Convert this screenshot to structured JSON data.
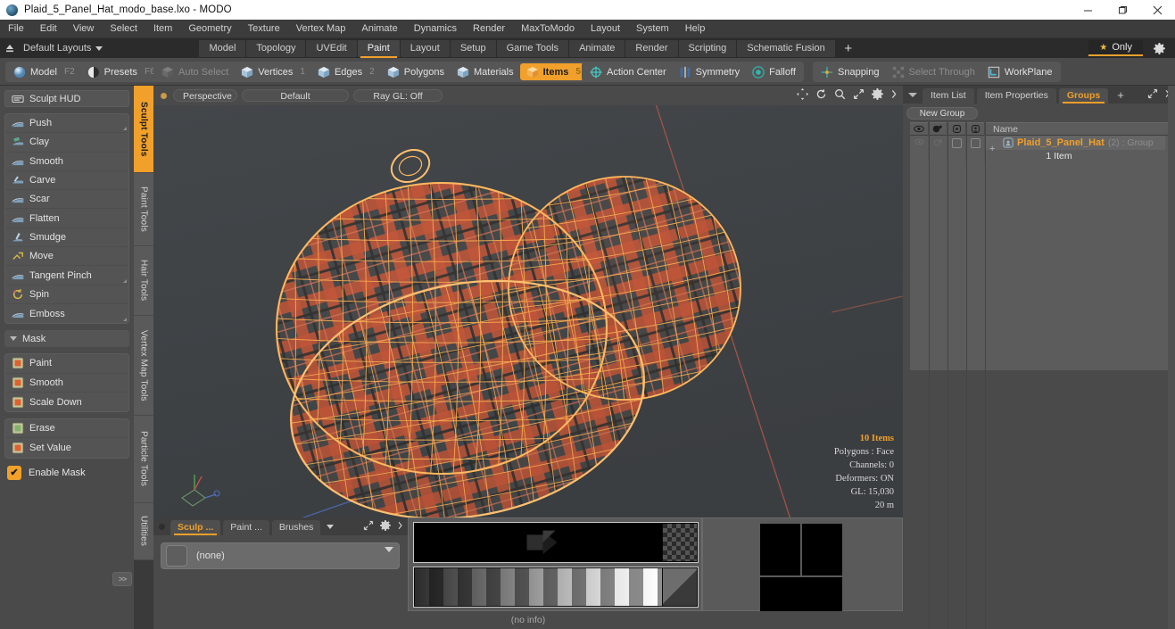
{
  "window": {
    "title": "Plaid_5_Panel_Hat_modo_base.lxo - MODO",
    "minimize": "—",
    "maximize": "❐",
    "close": "✕"
  },
  "menubar": {
    "items": [
      "File",
      "Edit",
      "View",
      "Select",
      "Item",
      "Geometry",
      "Texture",
      "Vertex Map",
      "Animate",
      "Dynamics",
      "Render",
      "MaxToModo",
      "Layout",
      "System",
      "Help"
    ]
  },
  "layoutbar": {
    "layouts_label": "Default Layouts",
    "tabs": [
      {
        "label": "Model",
        "active": false
      },
      {
        "label": "Topology",
        "active": false
      },
      {
        "label": "UVEdit",
        "active": false
      },
      {
        "label": "Paint",
        "active": true
      },
      {
        "label": "Layout",
        "active": false
      },
      {
        "label": "Setup",
        "active": false
      },
      {
        "label": "Game Tools",
        "active": false
      },
      {
        "label": "Animate",
        "active": false
      },
      {
        "label": "Render",
        "active": false
      },
      {
        "label": "Scripting",
        "active": false
      },
      {
        "label": "Schematic Fusion",
        "active": false
      }
    ],
    "add_label": "+",
    "only_label": "Only"
  },
  "modebar": {
    "left_group": [
      {
        "label": "Model",
        "key": "F2",
        "state": "normal",
        "icon": "sphere-icon"
      },
      {
        "label": "Presets",
        "key": "F6",
        "state": "normal",
        "icon": "preset-icon"
      }
    ],
    "select_group": [
      {
        "label": "Auto Select",
        "key": "",
        "state": "disabled",
        "icon": "cube-icon"
      },
      {
        "label": "Vertices",
        "key": "1",
        "state": "normal",
        "icon": "cube-icon"
      },
      {
        "label": "Edges",
        "key": "2",
        "state": "normal",
        "icon": "cube-icon"
      },
      {
        "label": "Polygons",
        "key": "",
        "state": "normal",
        "icon": "cube-icon"
      },
      {
        "label": "Materials",
        "key": "",
        "state": "normal",
        "icon": "cube-icon"
      },
      {
        "label": "Items",
        "key": "5",
        "state": "selected",
        "icon": "cube-icon"
      }
    ],
    "right_group": [
      {
        "label": "Action Center",
        "key": "",
        "state": "normal",
        "icon": "crosshair-icon"
      },
      {
        "label": "Symmetry",
        "key": "",
        "state": "normal",
        "icon": "symmetry-icon"
      },
      {
        "label": "Falloff",
        "key": "",
        "state": "normal",
        "icon": "falloff-icon"
      }
    ],
    "far_group": [
      {
        "label": "Snapping",
        "key": "",
        "state": "normal",
        "icon": "snapping-icon"
      },
      {
        "label": "Select Through",
        "key": "",
        "state": "disabled",
        "icon": "select-through-icon"
      },
      {
        "label": "WorkPlane",
        "key": "",
        "state": "normal",
        "icon": "workplane-icon"
      }
    ]
  },
  "left_panel": {
    "hud_label": "Sculpt HUD",
    "sculpt_tools": [
      {
        "label": "Push",
        "submenu": true
      },
      {
        "label": "Clay",
        "submenu": false
      },
      {
        "label": "Smooth",
        "submenu": false
      },
      {
        "label": "Carve",
        "submenu": false
      },
      {
        "label": "Scar",
        "submenu": false
      },
      {
        "label": "Flatten",
        "submenu": false
      },
      {
        "label": "Smudge",
        "submenu": false
      },
      {
        "label": "Move",
        "submenu": false
      },
      {
        "label": "Tangent Pinch",
        "submenu": true
      },
      {
        "label": "Spin",
        "submenu": false
      },
      {
        "label": "Emboss",
        "submenu": true
      }
    ],
    "mask_header": "Mask",
    "mask_tools": [
      {
        "label": "Paint"
      },
      {
        "label": "Smooth"
      },
      {
        "label": "Scale Down"
      }
    ],
    "mask_tools2": [
      {
        "label": "Erase"
      },
      {
        "label": "Set Value"
      }
    ],
    "enable_mask": {
      "label": "Enable Mask",
      "checked": true,
      "check_glyph": "✔"
    },
    "expand_label": ">>",
    "vertical_tabs": [
      {
        "label": "Sculpt Tools",
        "active": true
      },
      {
        "label": "Paint Tools",
        "active": false
      },
      {
        "label": "Hair Tools",
        "active": false
      },
      {
        "label": "Vertex Map Tools",
        "active": false
      },
      {
        "label": "Particle Tools",
        "active": false
      },
      {
        "label": "Utilities",
        "active": false
      }
    ]
  },
  "viewport": {
    "pills": [
      "Perspective",
      "Default",
      "Ray GL: Off"
    ],
    "icons": [
      "pan-icon",
      "rotate-icon",
      "zoom-icon",
      "fit-icon",
      "gear-icon",
      "chevron-right-icon"
    ],
    "stats": {
      "items": "10 Items",
      "polygons": "Polygons : Face",
      "channels": "Channels: 0",
      "deformers": "Deformers: ON",
      "gl": "GL: 15,030",
      "scale": "20 m"
    }
  },
  "bottom_panel": {
    "tabs": [
      {
        "label": "Sculp ...",
        "active": true
      },
      {
        "label": "Paint ...",
        "active": false
      },
      {
        "label": "Brushes",
        "active": false
      }
    ],
    "brush_value": "(none)",
    "status": "(no info)"
  },
  "right_panel": {
    "tabs": [
      {
        "label": "Item List",
        "active": false
      },
      {
        "label": "Item Properties",
        "active": false
      },
      {
        "label": "Groups",
        "active": true
      }
    ],
    "add_tab": "+",
    "new_group_label": "New Group",
    "columns": [
      "eye-icon",
      "render-icon",
      "lock-icon",
      "select-icon",
      "Name"
    ],
    "rows": [
      {
        "name": "Plaid_5_Panel_Hat",
        "count": "(2) : Group",
        "sub": "1 Item",
        "selected": true,
        "expander": "+"
      }
    ]
  },
  "colors": {
    "accent": "#f0a02b",
    "panel": "#4a4a4a",
    "viewport_bg": "#3f4245",
    "wireframe": "#f5a74a",
    "plaid_red": "#d6663f",
    "plaid_dark": "#2f4048",
    "titlebar": "#ffffff"
  }
}
